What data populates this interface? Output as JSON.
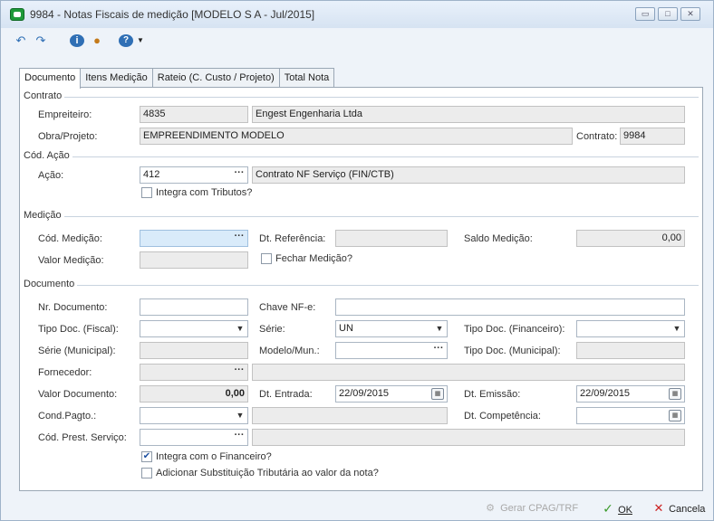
{
  "window": {
    "title": "9984 - Notas Fiscais de medição [MODELO S A - Jul/2015]"
  },
  "toolbar": {
    "icons": [
      "undo-icon",
      "redo-icon",
      "info-icon",
      "user-icon",
      "help-icon"
    ]
  },
  "tabs": [
    {
      "label": "Documento",
      "active": true
    },
    {
      "label": "Itens Medição",
      "active": false
    },
    {
      "label": "Rateio (C. Custo / Projeto)",
      "active": false
    },
    {
      "label": "Total Nota",
      "active": false
    }
  ],
  "contrato": {
    "section_title": "Contrato",
    "empreiteiro_label": "Empreiteiro:",
    "empreiteiro_code": "4835",
    "empreiteiro_name": "Engest Engenharia Ltda",
    "obra_label": "Obra/Projeto:",
    "obra_value": "EMPREENDIMENTO MODELO",
    "contrato_label": "Contrato:",
    "contrato_value": "9984"
  },
  "acao": {
    "section_title": "Cód. Ação",
    "acao_label": "Ação:",
    "acao_code": "412",
    "acao_desc": "Contrato NF Serviço (FIN/CTB)",
    "integra_tributos_label": "Integra com Tributos?",
    "integra_tributos_checked": false
  },
  "medicao": {
    "section_title": "Medição",
    "cod_label": "Cód. Medição:",
    "cod_value": "",
    "dt_ref_label": "Dt. Referência:",
    "dt_ref_value": "",
    "saldo_label": "Saldo Medição:",
    "saldo_value": "0,00",
    "valor_label": "Valor Medição:",
    "valor_value": "",
    "fechar_label": "Fechar Medição?",
    "fechar_checked": false
  },
  "documento": {
    "section_title": "Documento",
    "nr_doc_label": "Nr. Documento:",
    "nr_doc_value": "",
    "chave_label": "Chave NF-e:",
    "chave_value": "",
    "tipo_fiscal_label": "Tipo Doc. (Fiscal):",
    "tipo_fiscal_value": "",
    "serie_label": "Série:",
    "serie_value": "UN",
    "tipo_fin_label": "Tipo Doc. (Financeiro):",
    "tipo_fin_value": "",
    "serie_mun_label": "Série (Municipal):",
    "serie_mun_value": "",
    "modelo_mun_label": "Modelo/Mun.:",
    "modelo_mun_value": "",
    "tipo_mun_label": "Tipo Doc. (Municipal):",
    "tipo_mun_value": "",
    "fornecedor_label": "Fornecedor:",
    "fornecedor_code": "",
    "fornecedor_name": "",
    "valor_doc_label": "Valor Documento:",
    "valor_doc_value": "0,00",
    "dt_entrada_label": "Dt. Entrada:",
    "dt_entrada_value": "22/09/2015",
    "dt_emissao_label": "Dt. Emissão:",
    "dt_emissao_value": "22/09/2015",
    "cond_pagto_label": "Cond.Pagto.:",
    "cond_pagto_value": "",
    "dt_comp_label": "Dt. Competência:",
    "dt_comp_value": "",
    "cod_prest_label": "Cód. Prest. Serviço:",
    "cod_prest_value": "",
    "integra_fin_label": "Integra com o Financeiro?",
    "integra_fin_checked": true,
    "subst_trib_label": "Adicionar Substituição Tributária ao valor da nota?",
    "subst_trib_checked": false
  },
  "footer": {
    "gerar_label": "Gerar CPAG/TRF",
    "ok_label": "OK",
    "cancela_label": "Cancela"
  },
  "colors": {
    "ok_green": "#3a9a2a",
    "cancel_red": "#cc2222",
    "highlight_blue": "#d9ebfa"
  }
}
